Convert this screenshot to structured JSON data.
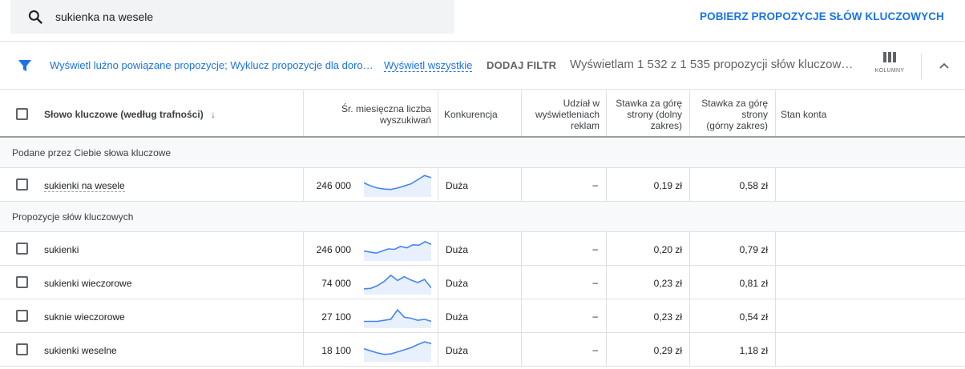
{
  "search": {
    "value": "sukienka na wesele"
  },
  "get_ideas_label": "POBIERZ PROPOZYCJE SŁÓW KLUCZOWYCH",
  "filters": {
    "chip_text": "Wyświetl luźno powiązane propozycje; Wyklucz propozycje dla doro…",
    "show_all": "Wyświetl wszystkie",
    "add_filter": "DODAJ FILTR",
    "showing_text": "Wyświetlam 1 532 z 1 535 propozycji słów kluczow…",
    "columns_label": "KOLUMNY"
  },
  "colors": {
    "accent": "#1a73e8",
    "spark_line": "#4285f4",
    "spark_fill": "#e8f0fe"
  },
  "table": {
    "headers": {
      "keyword": "Słowo kluczowe (według trafności)",
      "avg_searches_1": "Śr. miesięczna liczba",
      "avg_searches_2": "wyszukiwań",
      "competition": "Konkurencja",
      "share_1": "Udział w",
      "share_2": "wyświetleniach",
      "share_3": "reklam",
      "low_1": "Stawka za górę",
      "low_2": "strony (dolny",
      "low_3": "zakres)",
      "high_1": "Stawka za górę",
      "high_2": "strony",
      "high_3": "(górny zakres)",
      "account": "Stan konta"
    },
    "groups": [
      {
        "title": "Podane przez Ciebie słowa kluczowe",
        "rows": [
          {
            "keyword": "sukienki na wesele",
            "volume": "246 000",
            "trend": [
              60,
              45,
              35,
              30,
              28,
              35,
              45,
              55,
              75,
              95,
              85
            ],
            "competition": "Duża",
            "share": "–",
            "low": "0,19 zł",
            "high": "0,58 zł"
          }
        ]
      },
      {
        "title": "Propozycje słów kluczowych",
        "rows": [
          {
            "keyword": "sukienki",
            "volume": "246 000",
            "trend": [
              40,
              35,
              30,
              40,
              50,
              48,
              62,
              55,
              70,
              68,
              85,
              72
            ],
            "competition": "Duża",
            "share": "–",
            "low": "0,20 zł",
            "high": "0,79 zł"
          },
          {
            "keyword": "sukienki wieczorowe",
            "volume": "74 000",
            "trend": [
              20,
              22,
              35,
              55,
              85,
              60,
              78,
              62,
              50,
              65,
              25
            ],
            "competition": "Duża",
            "share": "–",
            "low": "0,23 zł",
            "high": "0,81 zł"
          },
          {
            "keyword": "suknie wieczorowe",
            "volume": "27 100",
            "trend": [
              25,
              25,
              25,
              30,
              35,
              80,
              45,
              40,
              30,
              35,
              25
            ],
            "competition": "Duża",
            "share": "–",
            "low": "0,23 zł",
            "high": "0,54 zł"
          },
          {
            "keyword": "sukienki weselne",
            "volume": "18 100",
            "trend": [
              55,
              45,
              35,
              28,
              30,
              40,
              50,
              60,
              75,
              88,
              80
            ],
            "competition": "Duża",
            "share": "–",
            "low": "0,29 zł",
            "high": "1,18 zł"
          }
        ]
      }
    ]
  }
}
